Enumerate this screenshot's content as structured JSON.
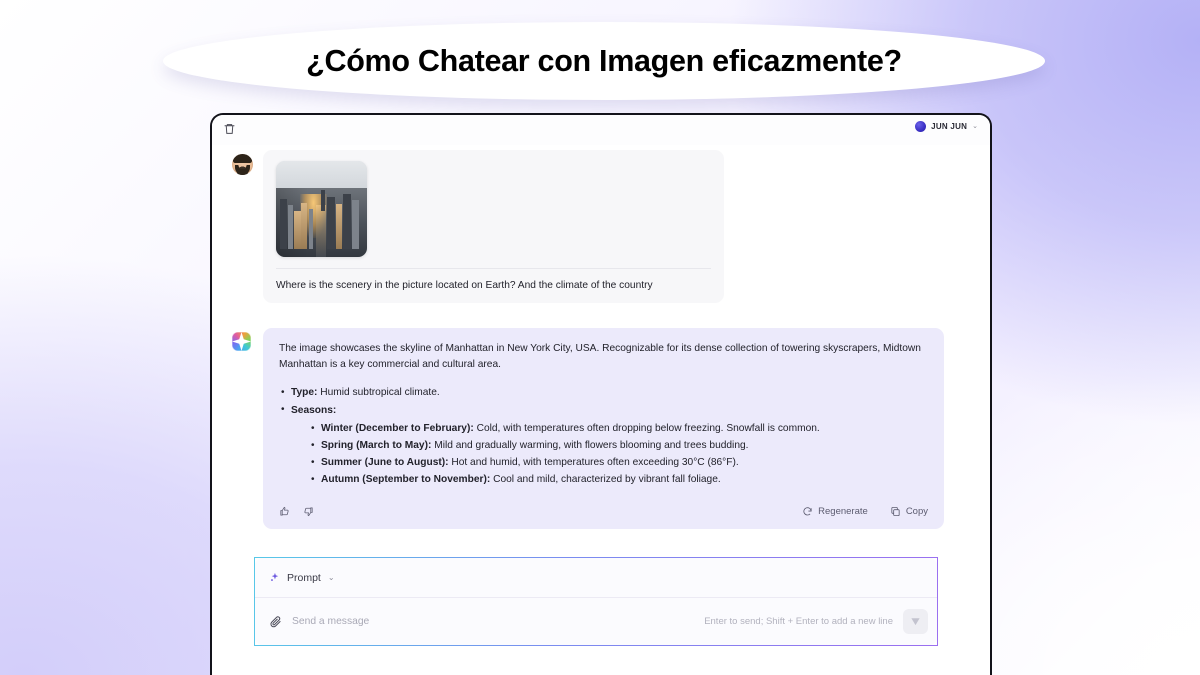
{
  "title": "¿Cómo Chatear con Imagen eficazmente?",
  "window": {
    "topbar": {
      "trash_icon": "trash-icon",
      "account_name": "JUN JUN",
      "account_caret": "⌄"
    }
  },
  "conversation": {
    "user_message": {
      "avatar": "user-avatar",
      "attachment_alt": "Manhattan skyline at sunset",
      "text": "Where is the scenery in the picture located on Earth? And the climate of the country"
    },
    "assistant_message": {
      "avatar": "ai-logo-icon",
      "paragraph": "The image showcases the skyline of Manhattan in New York City, USA. Recognizable for its dense collection of towering skyscrapers, Midtown Manhattan is a key commercial and cultural area.",
      "items": [
        {
          "label": "Type:",
          "text": " Humid subtropical climate."
        },
        {
          "label": "Seasons:",
          "text": ""
        }
      ],
      "seasons": [
        {
          "label": "Winter (December to February):",
          "text": " Cold, with temperatures often dropping below freezing. Snowfall is common."
        },
        {
          "label": "Spring (March to May):",
          "text": " Mild and gradually warming, with flowers blooming and trees budding."
        },
        {
          "label": "Summer (June to August):",
          "text": " Hot and humid, with temperatures often exceeding 30°C (86°F)."
        },
        {
          "label": "Autumn (September to November):",
          "text": " Cool and mild, characterized by vibrant fall foliage."
        }
      ],
      "actions": {
        "thumbs_up": "thumbs-up-icon",
        "thumbs_down": "thumbs-down-icon",
        "regenerate_label": "Regenerate",
        "copy_label": "Copy"
      }
    }
  },
  "composer": {
    "prompt_label": "Prompt",
    "prompt_caret": "⌄",
    "message_placeholder": "Send a message",
    "message_value": "",
    "hint": "Enter to send; Shift + Enter to add a new line",
    "attach_icon": "paperclip-icon",
    "send_icon": "send-icon"
  },
  "colors": {
    "accent_purple": "#6d5ae0",
    "bubble_ai": "#eceafb",
    "bubble_user": "#f7f7f9",
    "window_border": "#13131a",
    "background_tint": "#b4b1f6"
  }
}
